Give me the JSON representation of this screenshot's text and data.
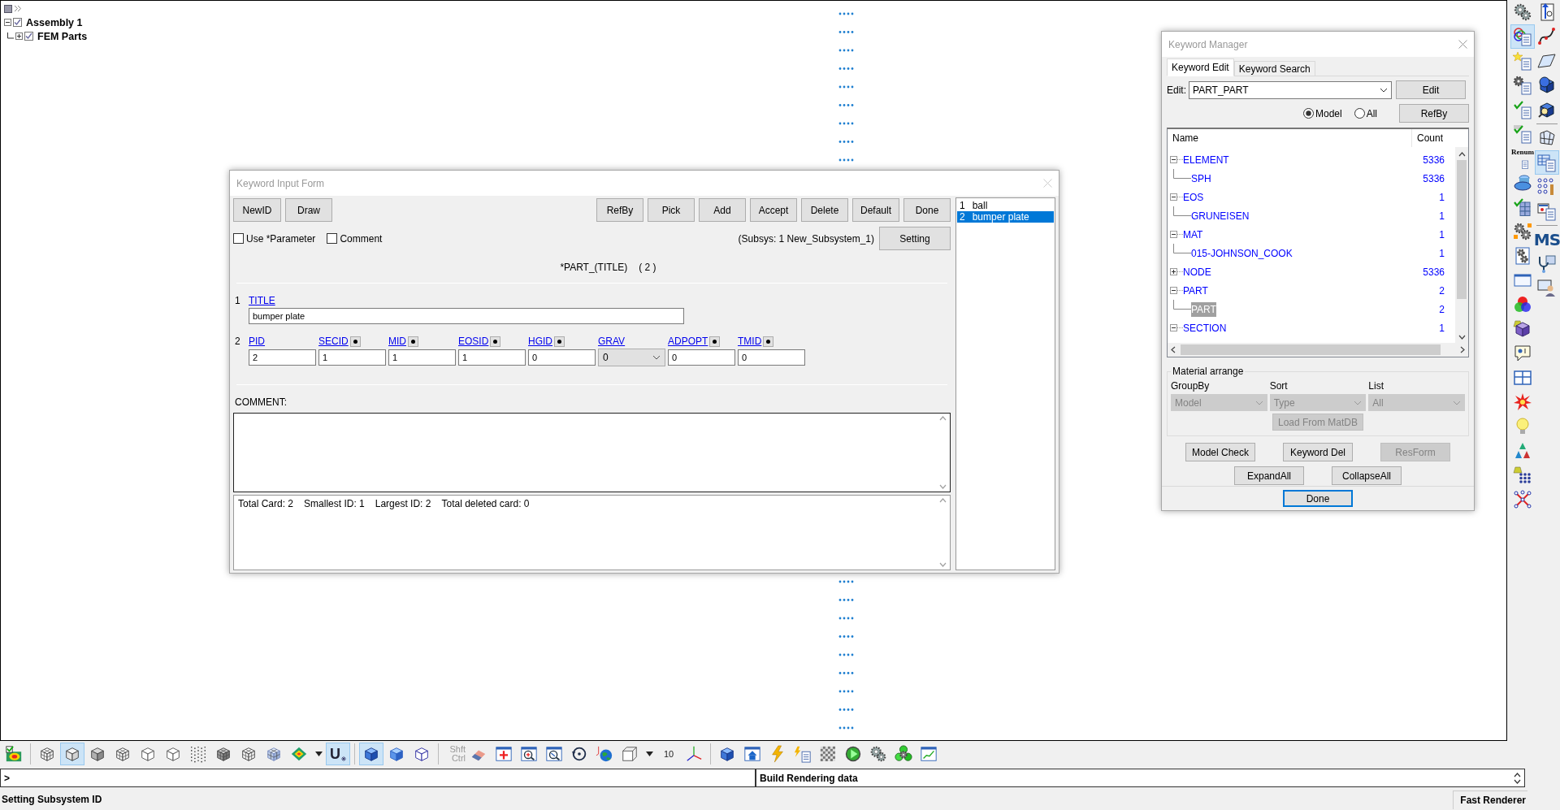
{
  "model_tree": [
    {
      "label": "Assembly 1",
      "checked": true,
      "expanded": true,
      "children": [
        {
          "label": "FEM Parts",
          "checked": true,
          "expanded": false
        }
      ]
    }
  ],
  "keyword_input_form": {
    "title": "Keyword Input Form",
    "left_buttons": [
      "NewID",
      "Draw"
    ],
    "right_buttons": [
      "RefBy",
      "Pick",
      "Add",
      "Accept",
      "Delete",
      "Default",
      "Done"
    ],
    "options": [
      {
        "label": "Use *Parameter",
        "checked": false
      },
      {
        "label": "Comment",
        "checked": false
      }
    ],
    "subsys": "(Subsys: 1 New_Subsystem_1)",
    "setting_button": "Setting",
    "keyword": "*PART_(TITLE)",
    "count": "( 2 )",
    "cards": [
      {
        "number": "1",
        "fields": [
          {
            "label": "TITLE",
            "value": "bumper plate",
            "kind": "wide"
          }
        ]
      },
      {
        "number": "2",
        "fields": [
          {
            "label": "PID",
            "value": "2",
            "kind": "text"
          },
          {
            "label": "SECID",
            "value": "1",
            "kind": "pick"
          },
          {
            "label": "MID",
            "value": "1",
            "kind": "pick"
          },
          {
            "label": "EOSID",
            "value": "1",
            "kind": "pick"
          },
          {
            "label": "HGID",
            "value": "0",
            "kind": "pick"
          },
          {
            "label": "GRAV",
            "value": "0",
            "kind": "select"
          },
          {
            "label": "ADPOPT",
            "value": "0",
            "kind": "pick"
          },
          {
            "label": "TMID",
            "value": "0",
            "kind": "pick"
          }
        ]
      }
    ],
    "comment_label": "COMMENT:",
    "summary": [
      "Total Card: 2",
      "Smallest ID: 1",
      "Largest ID: 2",
      "Total deleted card:  0"
    ],
    "entries": [
      {
        "number": "1",
        "name": "ball",
        "selected": false
      },
      {
        "number": "2",
        "name": "bumper plate",
        "selected": true
      }
    ]
  },
  "keyword_manager": {
    "title": "Keyword Manager",
    "tabs": [
      {
        "label": "Keyword Edit",
        "selected": true
      },
      {
        "label": "Keyword Search",
        "selected": false
      }
    ],
    "edit_label": "Edit:",
    "edit_value": "PART_PART",
    "edit_button": "Edit",
    "scope": [
      {
        "label": "Model",
        "selected": true
      },
      {
        "label": "All",
        "selected": false
      }
    ],
    "refby_button": "RefBy",
    "columns": [
      "Name",
      "Count"
    ],
    "tree": [
      {
        "name": "ELEMENT",
        "count": "5336",
        "expanded": true,
        "selected": false,
        "children": [
          {
            "name": "SPH",
            "count": "5336",
            "selected": false
          }
        ]
      },
      {
        "name": "EOS",
        "count": "1",
        "expanded": true,
        "selected": false,
        "children": [
          {
            "name": "GRUNEISEN",
            "count": "1",
            "selected": false
          }
        ]
      },
      {
        "name": "MAT",
        "count": "1",
        "expanded": true,
        "selected": false,
        "children": [
          {
            "name": "015-JOHNSON_COOK",
            "count": "1",
            "selected": false
          }
        ]
      },
      {
        "name": "NODE",
        "count": "5336",
        "expanded": false,
        "selected": false
      },
      {
        "name": "PART",
        "count": "2",
        "expanded": true,
        "selected": false,
        "children": [
          {
            "name": "PART",
            "count": "2",
            "selected": true
          }
        ]
      },
      {
        "name": "SECTION",
        "count": "1",
        "expanded": true,
        "selected": false
      }
    ],
    "material_arrange": {
      "title": "Material arrange",
      "selects": [
        {
          "label": "GroupBy",
          "value": "Model",
          "disabled": true
        },
        {
          "label": "Sort",
          "value": "Type",
          "disabled": true
        },
        {
          "label": "List",
          "value": "All",
          "disabled": true
        }
      ],
      "load_button": {
        "label": "Load From MatDB",
        "disabled": true
      }
    },
    "actions": [
      {
        "label": "Model Check",
        "disabled": false
      },
      {
        "label": "Keyword Del",
        "disabled": false
      },
      {
        "label": "ResForm",
        "disabled": true
      },
      {
        "label": "ExpandAll",
        "disabled": false
      },
      {
        "label": "CollapseAll",
        "disabled": false
      }
    ],
    "done_button": "Done"
  },
  "bottom_toolbar": [
    {
      "kind": "icon",
      "selected": false
    },
    {
      "kind": "separator"
    },
    {
      "kind": "icon",
      "selected": false
    },
    {
      "kind": "icon",
      "selected": true
    },
    {
      "kind": "icon",
      "selected": false
    },
    {
      "kind": "icon",
      "selected": false
    },
    {
      "kind": "icon",
      "selected": false
    },
    {
      "kind": "icon",
      "selected": false
    },
    {
      "kind": "icon",
      "selected": false
    },
    {
      "kind": "icon",
      "selected": false
    },
    {
      "kind": "icon",
      "selected": false
    },
    {
      "kind": "icon",
      "selected": false
    },
    {
      "kind": "icon",
      "selected": false
    },
    {
      "kind": "caret"
    },
    {
      "kind": "text",
      "text": "U",
      "selected": true
    },
    {
      "kind": "separator"
    },
    {
      "kind": "icon",
      "selected": true
    },
    {
      "kind": "icon",
      "selected": false
    },
    {
      "kind": "icon",
      "selected": false
    },
    {
      "kind": "separator"
    },
    {
      "kind": "modifier",
      "lines": [
        "Shft",
        "Ctrl"
      ]
    },
    {
      "kind": "icon",
      "selected": false
    },
    {
      "kind": "icon",
      "selected": false
    },
    {
      "kind": "icon",
      "selected": false
    },
    {
      "kind": "icon",
      "selected": false
    },
    {
      "kind": "icon",
      "selected": false
    },
    {
      "kind": "icon",
      "selected": false
    },
    {
      "kind": "icon",
      "selected": false
    },
    {
      "kind": "caret"
    },
    {
      "kind": "text",
      "text": "10",
      "selected": false
    },
    {
      "kind": "icon",
      "selected": false
    },
    {
      "kind": "separator"
    },
    {
      "kind": "icon",
      "selected": false
    },
    {
      "kind": "icon",
      "selected": false
    },
    {
      "kind": "icon",
      "selected": false
    },
    {
      "kind": "icon",
      "selected": false
    },
    {
      "kind": "icon",
      "selected": false
    },
    {
      "kind": "icon",
      "selected": false
    },
    {
      "kind": "icon",
      "selected": false
    },
    {
      "kind": "icon",
      "selected": false
    },
    {
      "kind": "icon",
      "selected": false
    }
  ],
  "right_toolbar": [
    [
      {
        "kind": "icon",
        "selected": false
      },
      {
        "kind": "icon",
        "selected": true
      },
      {
        "kind": "icon",
        "selected": false
      },
      {
        "kind": "icon",
        "selected": false
      },
      {
        "kind": "icon",
        "selected": false
      },
      {
        "kind": "icon",
        "selected": false
      },
      {
        "kind": "labeled",
        "text": "Renum",
        "selected": false
      },
      {
        "kind": "icon",
        "selected": false
      },
      {
        "kind": "icon",
        "selected": false
      },
      {
        "kind": "icon",
        "selected": false
      },
      {
        "kind": "icon",
        "selected": false
      },
      {
        "kind": "icon",
        "selected": false
      },
      {
        "kind": "icon",
        "selected": false
      },
      {
        "kind": "icon",
        "selected": false
      },
      {
        "kind": "icon",
        "selected": false
      },
      {
        "kind": "icon",
        "selected": false
      },
      {
        "kind": "icon",
        "selected": false
      },
      {
        "kind": "icon",
        "selected": false
      },
      {
        "kind": "icon",
        "selected": false
      },
      {
        "kind": "icon",
        "selected": false
      },
      {
        "kind": "icon",
        "selected": false
      }
    ],
    [
      {
        "kind": "icon",
        "selected": false
      },
      {
        "kind": "icon",
        "selected": false
      },
      {
        "kind": "icon",
        "selected": false
      },
      {
        "kind": "icon",
        "selected": false
      },
      {
        "kind": "icon",
        "selected": false
      },
      {
        "kind": "separator"
      },
      {
        "kind": "icon",
        "selected": false
      },
      {
        "kind": "icon",
        "selected": true
      },
      {
        "kind": "icon",
        "selected": false
      },
      {
        "kind": "icon",
        "selected": false
      },
      {
        "kind": "separator"
      },
      {
        "kind": "text",
        "text": "MS",
        "selected": false
      },
      {
        "kind": "icon",
        "selected": false
      },
      {
        "kind": "icon",
        "selected": false
      }
    ]
  ],
  "command_line": {
    "prompt": ">"
  },
  "message": "Build Rendering data",
  "status_bar": {
    "message": "Setting Subsystem ID",
    "renderer": "Fast Renderer"
  }
}
